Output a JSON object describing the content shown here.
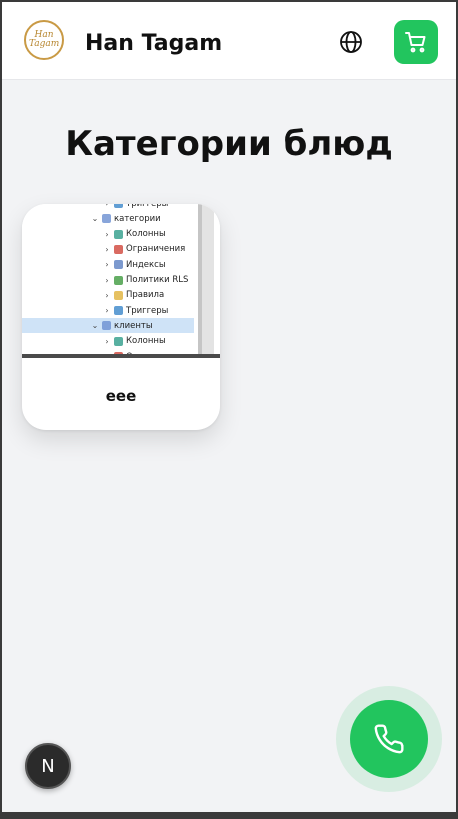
{
  "header": {
    "brand": "Han Tagam",
    "logo_text": "Han Tagam",
    "language_icon": "globe-icon",
    "cart_icon": "cart-icon",
    "accent": "#22c55e"
  },
  "main": {
    "title": "Категории блюд",
    "categories": [
      {
        "name": "eee",
        "image_tree": [
          {
            "label": "Триггеры",
            "icon": "trigger-icon",
            "expanded": false
          },
          {
            "label": "категории",
            "icon": "table-icon",
            "expanded": true
          },
          {
            "label": "Колонны",
            "icon": "columns-icon",
            "expanded": false
          },
          {
            "label": "Ограничения",
            "icon": "constraints-icon",
            "expanded": false
          },
          {
            "label": "Индексы",
            "icon": "indexes-icon",
            "expanded": false
          },
          {
            "label": "Политики RLS",
            "icon": "policy-icon",
            "expanded": false
          },
          {
            "label": "Правила",
            "icon": "rules-icon",
            "expanded": false
          },
          {
            "label": "Триггеры",
            "icon": "trigger-icon",
            "expanded": false
          },
          {
            "label": "клиенты",
            "icon": "table-icon",
            "expanded": true,
            "selected": true
          },
          {
            "label": "Колонны",
            "icon": "columns-icon",
            "expanded": false
          },
          {
            "label": "Ограничения",
            "icon": "constraints-icon",
            "expanded": false
          }
        ]
      }
    ]
  },
  "floating": {
    "next_badge_letter": "N",
    "call_icon": "phone-icon"
  }
}
